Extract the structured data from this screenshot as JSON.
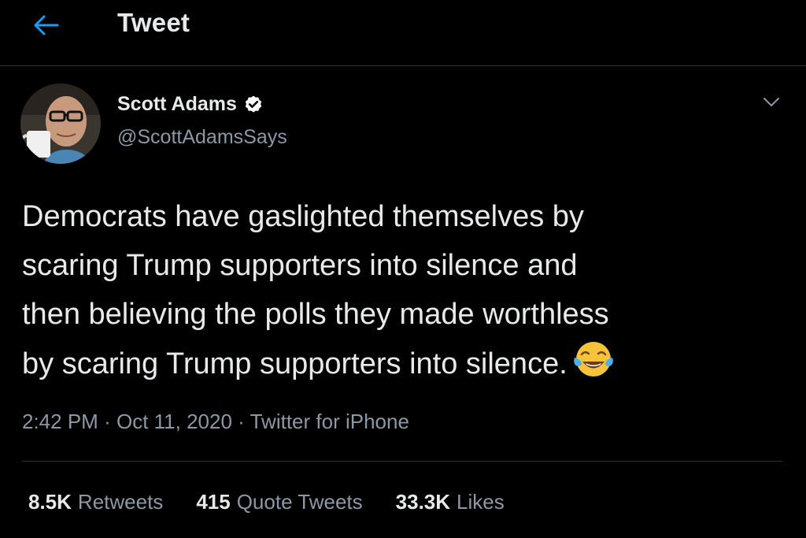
{
  "header": {
    "title": "Tweet",
    "back_icon": "arrow-left-icon"
  },
  "author": {
    "name": "Scott Adams",
    "handle": "@ScottAdamsSays",
    "verified_icon": "verified-badge-icon"
  },
  "tweet": {
    "lines": [
      "Democrats have gaslighted themselves by",
      "scaring Trump supporters into silence and",
      "then believing the polls they made worthless",
      "by scaring Trump supporters into silence."
    ],
    "emoji_icon": "tears-of-joy-emoji-icon"
  },
  "meta": {
    "time": "2:42 PM",
    "separator": "·",
    "date": "Oct 11, 2020",
    "source": "Twitter for iPhone"
  },
  "stats": {
    "retweets_count": "8.5K",
    "retweets_label": "Retweets",
    "quotes_count": "415",
    "quotes_label": "Quote Tweets",
    "likes_count": "33.3K",
    "likes_label": "Likes"
  },
  "colors": {
    "background": "#000000",
    "accent": "#1d9bf0",
    "primary_text": "#e7e9ea",
    "secondary_text": "#8b98a5",
    "divider": "#2f3336"
  }
}
